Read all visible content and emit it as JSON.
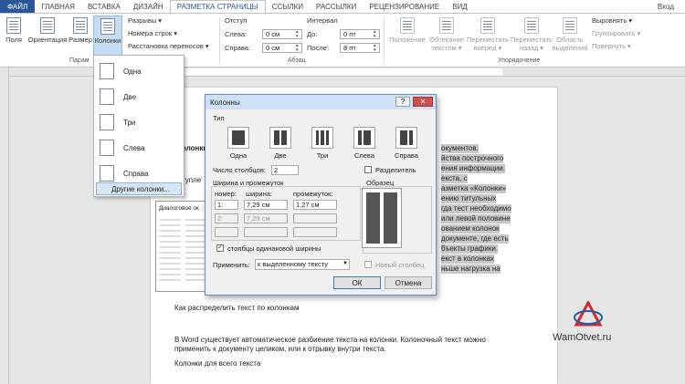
{
  "tabs": {
    "file": "ФАЙЛ",
    "items": [
      "ГЛАВНАЯ",
      "ВСТАВКА",
      "ДИЗАЙН",
      "РАЗМЕТКА СТРАНИЦЫ",
      "ССЫЛКИ",
      "РАССЫЛКИ",
      "РЕЦЕНЗИРОВАНИЕ",
      "ВИД"
    ],
    "login": "Вход"
  },
  "ribbon": {
    "fields": "Поля",
    "orientation": "Ориентация",
    "size": "Размер",
    "columns": "Колонки",
    "breaks": "Разрывы ▾",
    "line_numbers": "Номера строк ▾",
    "hyphenation": "Расстановка переносов ▾",
    "group_page": "Парам",
    "indent": "Отступ",
    "left": "Слева:",
    "right": "Справа:",
    "left_val": "0 см",
    "right_val": "0 см",
    "spacing": "Интервал",
    "before": "До:",
    "after": "После:",
    "before_val": "0 пт",
    "after_val": "8 пт",
    "group_paragraph": "Абзац",
    "position": "Положение",
    "wrap": "Обтекание\nтекстом ▾",
    "bring_forward": "Переместить\nвперед ▾",
    "send_backward": "Переместить\nназад ▾",
    "selection_pane": "Область\nвыделения",
    "align": "Выровнять ▾",
    "group": "Группировать ▾",
    "rotate": "Повернуть ▾",
    "group_arrange": "Упорядочение"
  },
  "columns_menu": {
    "items": [
      "Одна",
      "Две",
      "Три",
      "Слева",
      "Справа"
    ],
    "more": "Другие колонки..."
  },
  "dialog": {
    "title": "Колонны",
    "help": "?",
    "close": "✕",
    "type_label": "Тип",
    "presets": [
      "Одна",
      "Две",
      "Три",
      "Слева",
      "Справа"
    ],
    "num_columns_label": "Число столбцов:",
    "num_columns": "2",
    "separator": "Разделитель",
    "width_spacing": "Ширина и промежуток",
    "col_number": "номер:",
    "col_width": "ширина:",
    "col_gap": "промежуток:",
    "row1": {
      "n": "1:",
      "w": "7,29 см",
      "g": "1,27 см"
    },
    "row2": {
      "n": "2:",
      "w": "7,29 см",
      "g": ""
    },
    "row3": {
      "n": "",
      "w": "",
      "g": ""
    },
    "equal_width": "столбцы одинаковой ширины",
    "sample": "Образец",
    "apply_label": "Применить:",
    "apply_value": "к выделенному тексту",
    "new_column": "Новый столбец",
    "ok": "ОК",
    "cancel": "Отмена"
  },
  "thumb_title": "Диалоговое ок",
  "document": {
    "bold_frag": "олонки",
    "frag_tupl": "тупле",
    "right_lines": [
      "окументов.",
      "йства построчного",
      "ения информации.",
      "екста, с",
      "азметка «Колонки»",
      "ению титульных",
      "гда тест необходимо",
      "или левой половине",
      "ованием колонок",
      "документе, где есть",
      "бъекты графики.",
      "екст в колонках",
      "ньше нагрузка на"
    ],
    "heading": "Как распределить текст по колонкам",
    "para1_line1": "В Word существует автоматическое разбиение текста на колонки. Колоночный текст можно",
    "para1_line2": "применить к документу целиком, или к отрывку внутри текста.",
    "para2": "Колонки для всего текста"
  },
  "logo_text": "WamOtvet.ru",
  "colors": {
    "accent": "#2b579a",
    "logo_red": "#d8262a",
    "logo_blue": "#1f5fa8"
  }
}
